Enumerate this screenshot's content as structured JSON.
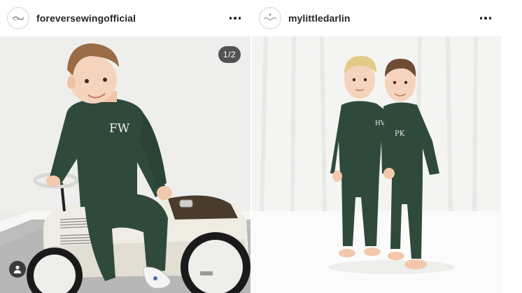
{
  "posts": [
    {
      "username": "foreversewingofficial",
      "avatar_icon": "forever-sewing-logo",
      "more_icon": "more-options-icon",
      "carousel_counter": "1/2",
      "tag_icon": "user-tag-icon",
      "monogram": "FW"
    },
    {
      "username": "mylittledarlin",
      "avatar_icon": "my-little-darlin-logo",
      "more_icon": "more-options-icon",
      "monograms": [
        "HV",
        "PK"
      ]
    }
  ],
  "colors": {
    "outfit_green": "#2f4a3a",
    "text_primary": "#262626",
    "border": "#dbdbdb"
  }
}
